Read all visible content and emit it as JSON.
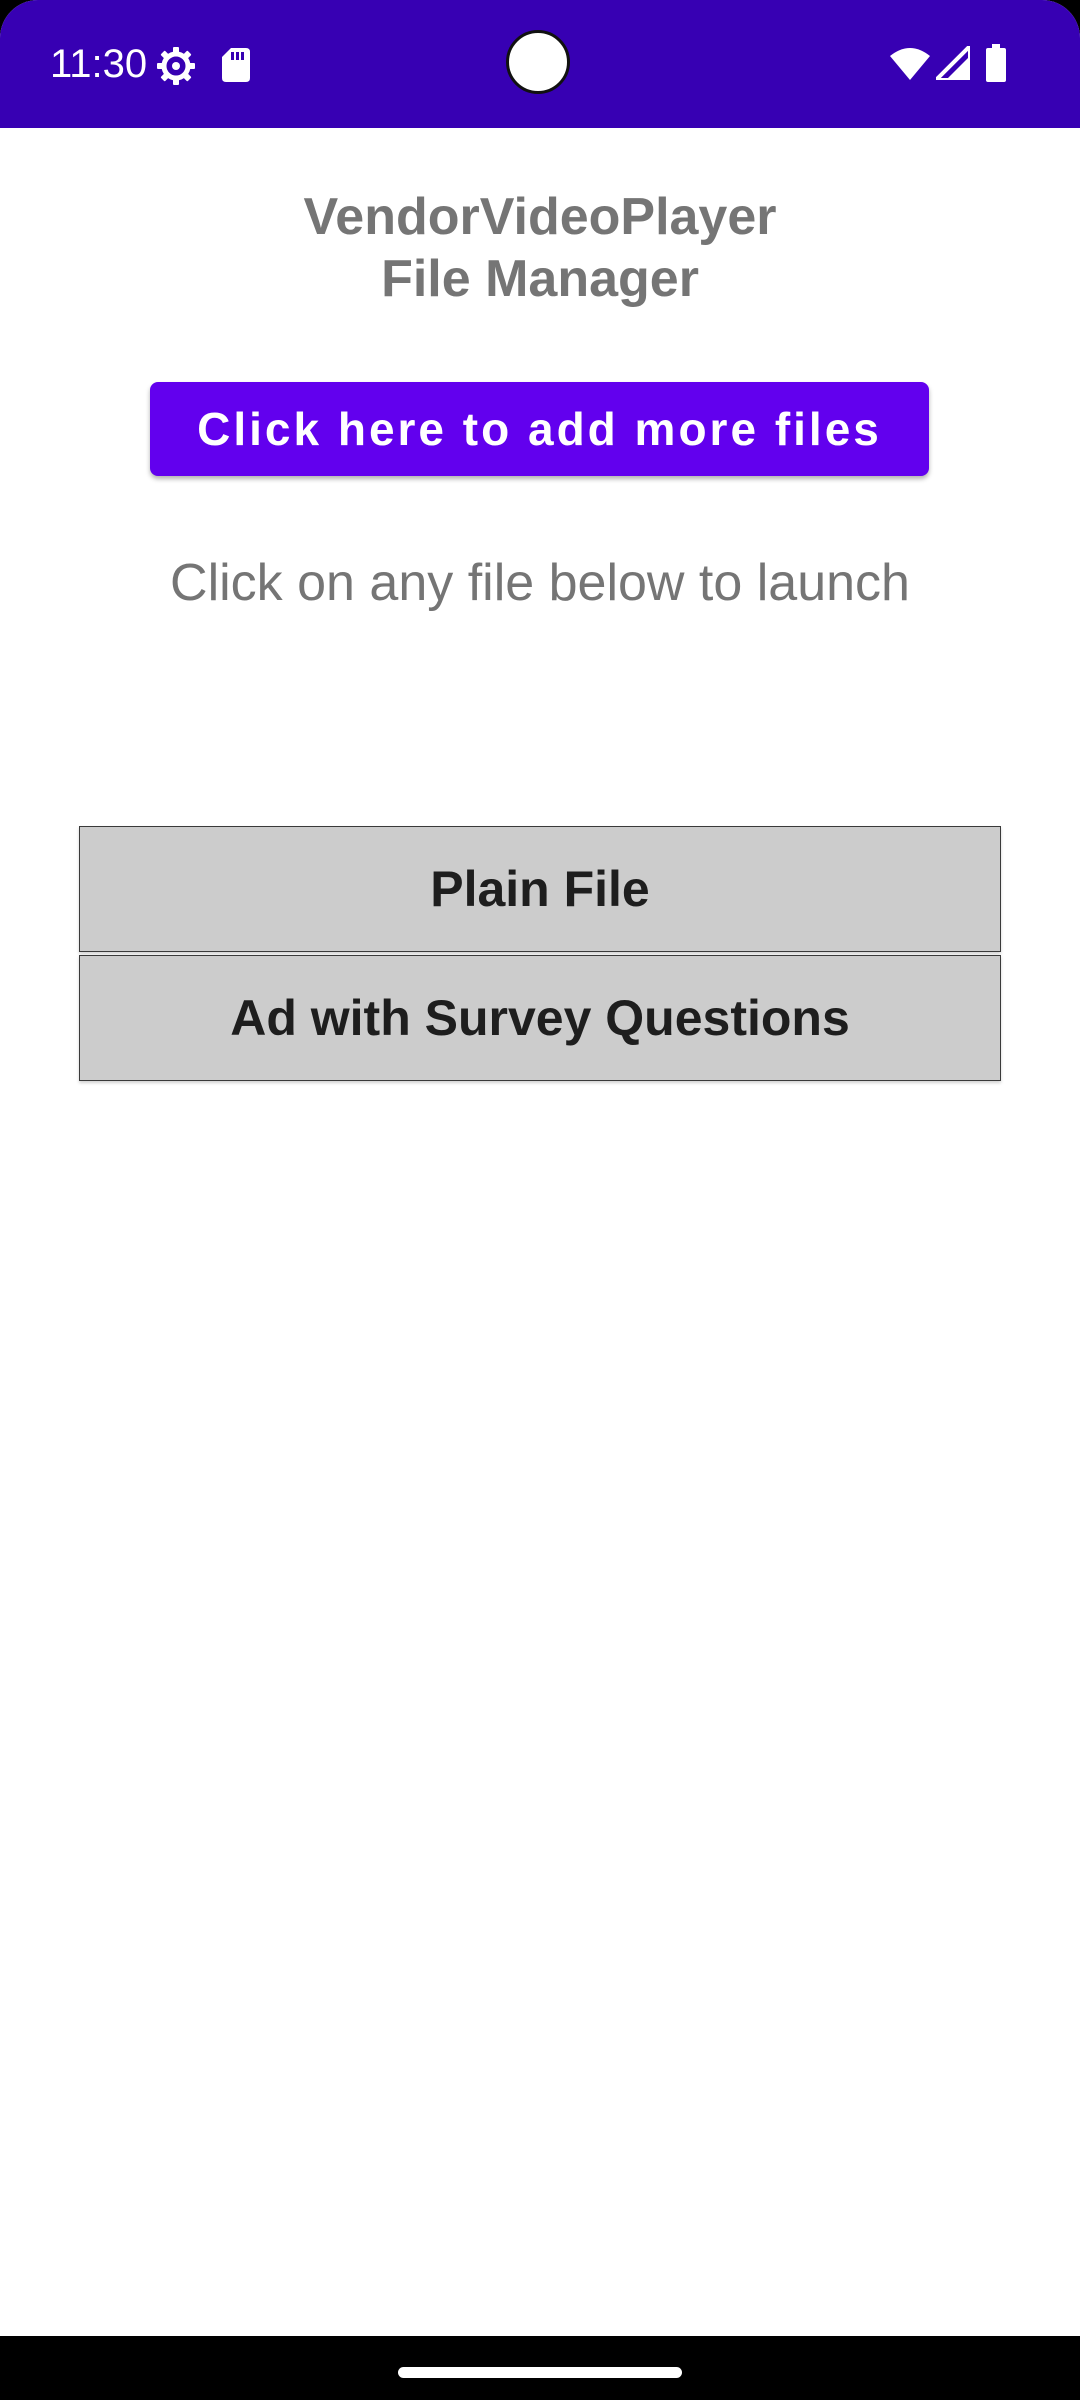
{
  "status_bar": {
    "time": "11:30",
    "icons": [
      "settings-gear-icon",
      "sd-card-icon",
      "wifi-icon",
      "cell-signal-icon",
      "battery-icon"
    ],
    "background_color": "#3700b3"
  },
  "header": {
    "title_line1": "VendorVideoPlayer",
    "title_line2": "File Manager"
  },
  "actions": {
    "add_files_label": "Click here to add more files",
    "accent_color": "#6200ee"
  },
  "instruction": "Click on any file below to launch",
  "files": [
    {
      "label": "Plain File"
    },
    {
      "label": "Ad with Survey Questions"
    }
  ],
  "file_button_color": "#cccccc"
}
